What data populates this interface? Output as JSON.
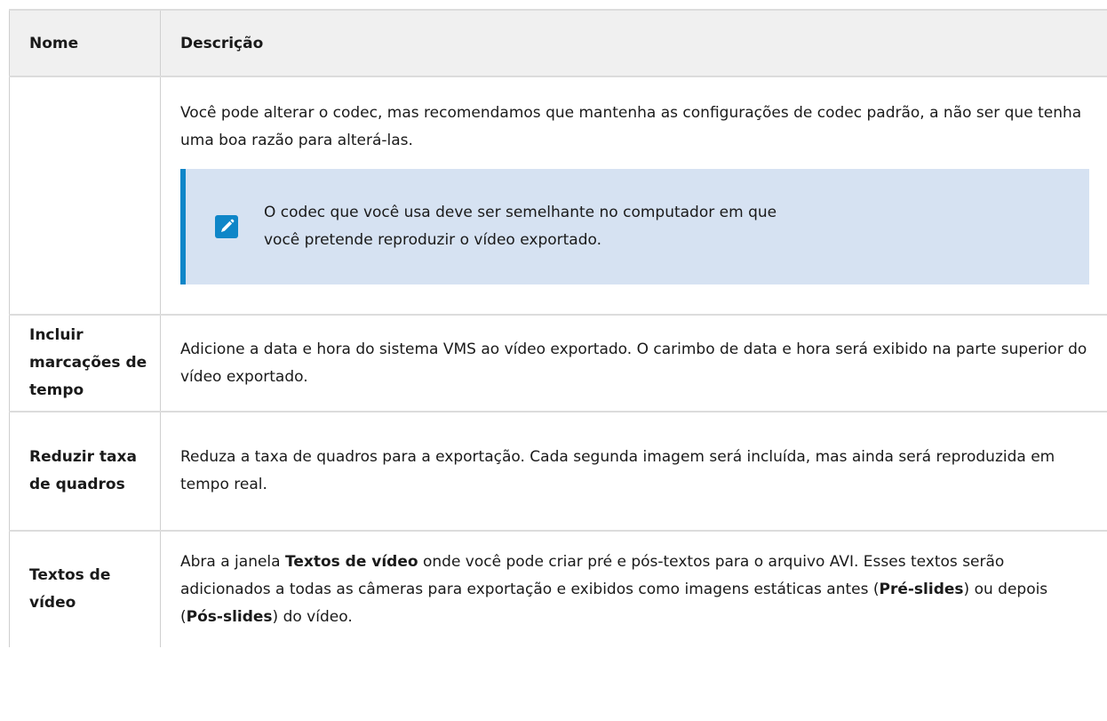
{
  "table": {
    "header": {
      "name": "Nome",
      "description": "Descrição"
    },
    "rows": [
      {
        "name": "",
        "description": "Você pode alterar o codec, mas recomendamos que mantenha as configurações de codec padrão, a não ser que tenha uma boa razão para alterá-las.",
        "note": {
          "icon": "pencil-note-icon",
          "text": "O codec que você usa deve ser semelhante no computador em que você pretende reproduzir o vídeo exportado."
        }
      },
      {
        "name": "Incluir marcações de tempo",
        "description": "Adicione a data e hora do sistema VMS ao vídeo exportado. O carimbo de data e hora será exibido na parte superior do vídeo exportado."
      },
      {
        "name": "Reduzir taxa de quadros",
        "description": "Reduza a taxa de quadros para a exportação. Cada segunda imagem será incluída, mas ainda será reproduzida em tempo real."
      },
      {
        "name": "Textos de vídeo",
        "description_parts": {
          "p1": "Abra a janela ",
          "b1": "Textos de vídeo",
          "p2": " onde você pode criar pré e pós-textos para o arquivo AVI. Esses textos serão adicionados a todas as câmeras para exportação e exibidos como imagens estáticas antes (",
          "b2": "Pré-slides",
          "p3": ") ou depois (",
          "b3": "Pós-slides",
          "p4": ") do vídeo."
        }
      }
    ]
  },
  "colors": {
    "header_bg": "#f0f0f0",
    "note_bg": "#d6e2f2",
    "note_accent": "#0f86c8",
    "border": "#dcdcdc"
  }
}
